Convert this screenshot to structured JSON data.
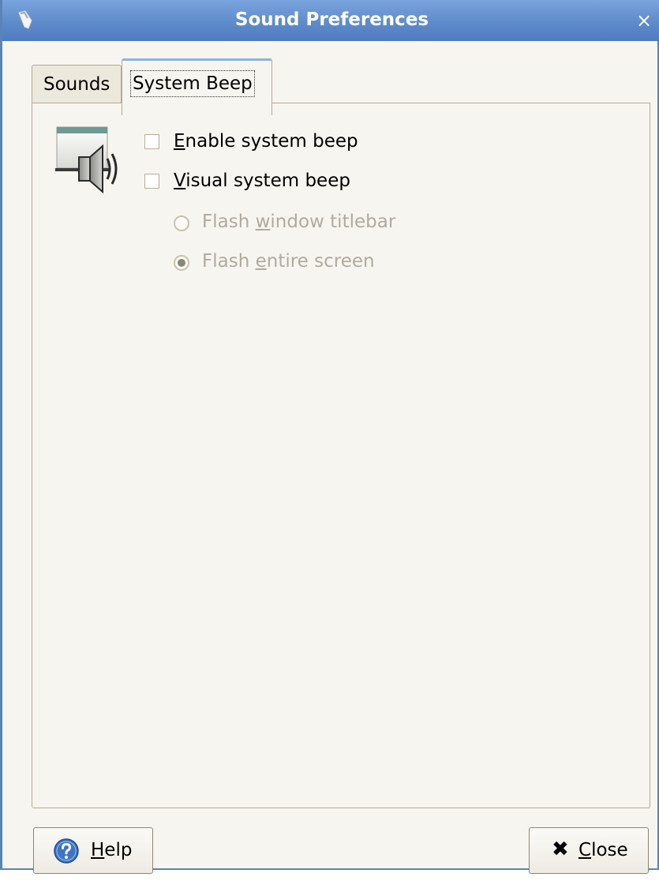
{
  "window": {
    "title": "Sound Preferences",
    "close_glyph": "×"
  },
  "tabs": [
    {
      "label": "Sounds",
      "selected": false
    },
    {
      "label": "System Beep",
      "selected": true
    }
  ],
  "system_beep": {
    "enable_beep": {
      "mnemonic": "E",
      "rest": "nable system beep",
      "checked": false
    },
    "visual_beep": {
      "mnemonic": "V",
      "rest": "isual system beep",
      "checked": false
    },
    "flash_titlebar": {
      "before": "Flash ",
      "mnemonic": "w",
      "rest": "indow titlebar",
      "selected": false,
      "enabled": false
    },
    "flash_screen": {
      "before": "Flash ",
      "mnemonic": "e",
      "rest": "ntire screen",
      "selected": true,
      "enabled": false
    }
  },
  "buttons": {
    "help": {
      "mnemonic": "H",
      "rest": "elp",
      "icon": "help-icon"
    },
    "close": {
      "mnemonic": "C",
      "rest": "lose",
      "icon": "close-x-icon",
      "glyph": "✖"
    }
  },
  "colors": {
    "titlebar": "#5e8bcb",
    "window_bg": "#f7f5ef",
    "disabled_text": "#b0aba0",
    "help_icon": "#3f74c4"
  }
}
